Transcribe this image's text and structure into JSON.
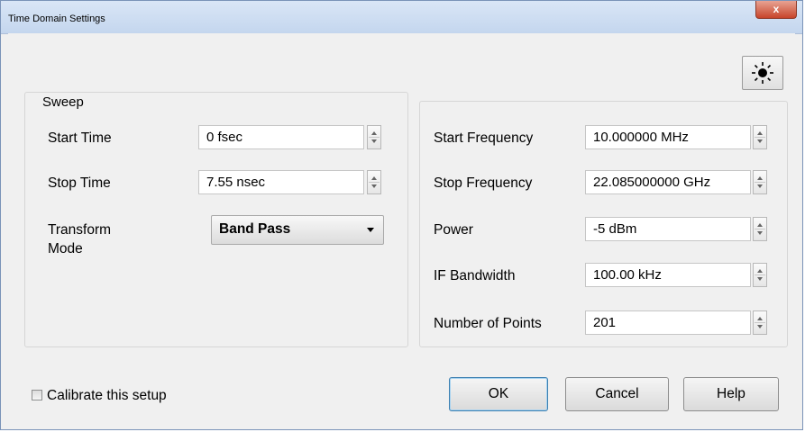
{
  "window": {
    "title": "Time Domain Settings",
    "close_label": "x"
  },
  "toolbar": {
    "icon": "sun-icon"
  },
  "sweep_group": {
    "legend": "Sweep",
    "start_time": {
      "label": "Start Time",
      "value": "0 fsec"
    },
    "stop_time": {
      "label": "Stop Time",
      "value": "7.55 nsec"
    },
    "transform_mode": {
      "label_line1": "Transform",
      "label_line2": "Mode",
      "value": "Band Pass"
    }
  },
  "frequency_group": {
    "start_frequency": {
      "label": "Start Frequency",
      "value": "10.000000 MHz"
    },
    "stop_frequency": {
      "label": "Stop Frequency",
      "value": "22.085000000 GHz"
    },
    "power": {
      "label": "Power",
      "value": "-5 dBm"
    },
    "if_bandwidth": {
      "label": "IF Bandwidth",
      "value": "100.00 kHz"
    },
    "number_of_points": {
      "label": "Number of Points",
      "value": "201"
    }
  },
  "footer": {
    "calibrate": {
      "label": "Calibrate this setup",
      "checked": false
    },
    "ok_label": "OK",
    "cancel_label": "Cancel",
    "help_label": "Help"
  },
  "colors": {
    "titlebar": "#c4d6ee",
    "close": "#c7452b",
    "dialog_bg": "#f0f0f0",
    "focus_border": "#3c7fb1"
  }
}
